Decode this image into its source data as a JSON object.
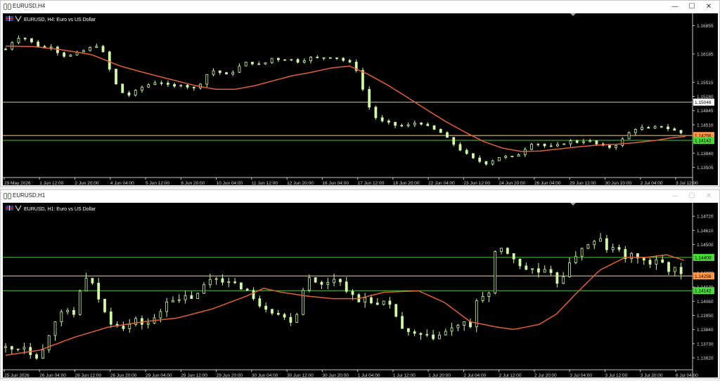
{
  "windows": [
    {
      "title": "EURUSD,H4",
      "header": "EURUSD, H4:  Euro vs US Dollar",
      "controls": {
        "minimize": "—",
        "maximize": "☐",
        "close": "✕"
      },
      "chart_data": {
        "type": "candlestick",
        "symbol": "EURUSD",
        "timeframe": "H4",
        "description": "Euro vs US Dollar",
        "y_ticks": [
          "1.16855",
          "1.16185",
          "1.15515",
          "1.15180",
          "1.14845",
          "1.14510",
          "1.13840",
          "1.13505"
        ],
        "y_tick_values": [
          1.16855,
          1.16185,
          1.15515,
          1.1518,
          1.14845,
          1.1451,
          1.1384,
          1.13505
        ],
        "ylim": [
          1.1333,
          1.1698
        ],
        "x_ticks": [
          "29 May 2026",
          "1 Jun 12:00",
          "2 Jun 20:00",
          "4 Jun 04:00",
          "5 Jun 12:00",
          "8 Jun 20:00",
          "10 Jun 04:00",
          "11 Jun 12:00",
          "12 Jun 20:00",
          "16 Jun 04:00",
          "17 Jun 12:00",
          "18 Jun 20:00",
          "22 Jun 04:00",
          "23 Jun 12:00",
          "24 Jun 20:00",
          "26 Jun 04:00",
          "29 Jun 12:00",
          "30 Jun 20:00",
          "2 Jul 04:00",
          "3 Jul 12:00"
        ],
        "hlines": [
          {
            "label": "1.15046",
            "value": 1.15046,
            "color": "#d8d818",
            "label_bg": "#ffffff",
            "label_fg": "#000000"
          },
          {
            "label": "1.14256",
            "value": 1.14256,
            "color": "#ffd080",
            "label_bg": "#ff9a4a",
            "label_fg": "#000000"
          },
          {
            "label": "1.14142",
            "value": 1.14142,
            "color": "#4ac83a",
            "label_bg": "#4ad83a",
            "label_fg": "#000000"
          }
        ],
        "colors": {
          "candle": "#d0f8a8",
          "ma": "#e0603a",
          "axis_text": "#d8d8d8"
        },
        "ma_points": [
          [
            0,
            1.1637
          ],
          [
            15,
            1.1636
          ],
          [
            30,
            1.1628
          ],
          [
            45,
            1.1617
          ],
          [
            60,
            1.159
          ],
          [
            72,
            1.1575
          ],
          [
            85,
            1.156
          ],
          [
            100,
            1.1543
          ],
          [
            110,
            1.1535
          ],
          [
            120,
            1.1535
          ],
          [
            130,
            1.1543
          ],
          [
            140,
            1.1555
          ],
          [
            150,
            1.1567
          ],
          [
            160,
            1.1575
          ],
          [
            170,
            1.1585
          ],
          [
            180,
            1.159
          ],
          [
            190,
            1.157
          ],
          [
            200,
            1.1545
          ],
          [
            210,
            1.1517
          ],
          [
            220,
            1.1488
          ],
          [
            230,
            1.146
          ],
          [
            240,
            1.1435
          ],
          [
            250,
            1.1412
          ],
          [
            260,
            1.1396
          ],
          [
            270,
            1.1388
          ],
          [
            280,
            1.1389
          ],
          [
            290,
            1.1394
          ],
          [
            300,
            1.1399
          ],
          [
            310,
            1.1403
          ],
          [
            320,
            1.1405
          ],
          [
            330,
            1.1409
          ],
          [
            340,
            1.1414
          ],
          [
            350,
            1.1421
          ],
          [
            360,
            1.1425
          ]
        ],
        "close_points": [
          [
            0,
            1.163
          ],
          [
            4,
            1.165
          ],
          [
            8,
            1.1662
          ],
          [
            12,
            1.165
          ],
          [
            16,
            1.164
          ],
          [
            20,
            1.1632
          ],
          [
            24,
            1.1638
          ],
          [
            28,
            1.162
          ],
          [
            32,
            1.1612
          ],
          [
            36,
            1.1618
          ],
          [
            40,
            1.1625
          ],
          [
            44,
            1.1632
          ],
          [
            48,
            1.164
          ],
          [
            52,
            1.1615
          ],
          [
            56,
            1.156
          ],
          [
            60,
            1.153
          ],
          [
            64,
            1.152
          ],
          [
            68,
            1.153
          ],
          [
            72,
            1.1542
          ],
          [
            76,
            1.1548
          ],
          [
            80,
            1.1555
          ],
          [
            84,
            1.1545
          ],
          [
            88,
            1.154
          ],
          [
            92,
            1.1548
          ],
          [
            96,
            1.154
          ],
          [
            100,
            1.1535
          ],
          [
            104,
            1.1565
          ],
          [
            108,
            1.158
          ],
          [
            112,
            1.1575
          ],
          [
            116,
            1.1568
          ],
          [
            120,
            1.158
          ],
          [
            124,
            1.1595
          ],
          [
            128,
            1.16
          ],
          [
            132,
            1.1592
          ],
          [
            136,
            1.1598
          ],
          [
            140,
            1.161
          ],
          [
            144,
            1.1605
          ],
          [
            148,
            1.1608
          ],
          [
            152,
            1.16
          ],
          [
            156,
            1.1605
          ],
          [
            160,
            1.161
          ],
          [
            164,
            1.1608
          ],
          [
            168,
            1.1612
          ],
          [
            172,
            1.1612
          ],
          [
            176,
            1.1605
          ],
          [
            180,
            1.1598
          ],
          [
            184,
            1.158
          ],
          [
            188,
            1.152
          ],
          [
            192,
            1.1475
          ],
          [
            196,
            1.146
          ],
          [
            200,
            1.1455
          ],
          [
            204,
            1.145
          ],
          [
            208,
            1.1448
          ],
          [
            212,
            1.145
          ],
          [
            216,
            1.146
          ],
          [
            220,
            1.1448
          ],
          [
            224,
            1.144
          ],
          [
            228,
            1.1432
          ],
          [
            232,
            1.1415
          ],
          [
            236,
            1.14
          ],
          [
            240,
            1.1385
          ],
          [
            244,
            1.1372
          ],
          [
            248,
            1.1365
          ],
          [
            252,
            1.136
          ],
          [
            256,
            1.137
          ],
          [
            260,
            1.1378
          ],
          [
            264,
            1.1372
          ],
          [
            268,
            1.138
          ],
          [
            272,
            1.1395
          ],
          [
            276,
            1.141
          ],
          [
            280,
            1.1405
          ],
          [
            284,
            1.1398
          ],
          [
            288,
            1.14
          ],
          [
            292,
            1.1408
          ],
          [
            296,
            1.1412
          ],
          [
            300,
            1.141
          ],
          [
            304,
            1.1415
          ],
          [
            308,
            1.1408
          ],
          [
            312,
            1.14
          ],
          [
            316,
            1.1398
          ],
          [
            320,
            1.1405
          ],
          [
            324,
            1.142
          ],
          [
            328,
            1.144
          ],
          [
            332,
            1.1445
          ],
          [
            336,
            1.144
          ],
          [
            340,
            1.1445
          ],
          [
            344,
            1.1448
          ],
          [
            348,
            1.144
          ],
          [
            352,
            1.1435
          ],
          [
            356,
            1.1428
          ]
        ]
      }
    },
    {
      "title": "EURUSD,H1",
      "header": "EURUSD, H1:  Euro vs US Dollar",
      "controls": {
        "minimize": "—",
        "maximize": "☐",
        "close": "✕"
      },
      "chart_data": {
        "type": "candlestick",
        "symbol": "EURUSD",
        "timeframe": "H1",
        "description": "Euro vs US Dollar",
        "y_ticks": [
          "1.14720",
          "1.14610",
          "1.14500",
          "1.14280",
          "1.14170",
          "1.14060",
          "1.13950",
          "1.13840",
          "1.13730",
          "1.13620"
        ],
        "y_tick_values": [
          1.1472,
          1.1461,
          1.145,
          1.1428,
          1.1417,
          1.1406,
          1.1395,
          1.1384,
          1.1373,
          1.1362
        ],
        "ylim": [
          1.1356,
          1.1477
        ],
        "x_ticks": [
          "25 Jun 2026",
          "26 Jun 04:00",
          "26 Jun 12:00",
          "26 Jun 20:00",
          "29 Jun 04:00",
          "29 Jun 12:00",
          "29 Jun 20:00",
          "30 Jun 04:00",
          "30 Jun 12:00",
          "30 Jun 20:00",
          "1 Jul 04:00",
          "1 Jul 12:00",
          "1 Jul 20:00",
          "2 Jul 04:00",
          "2 Jul 12:00",
          "2 Jul 20:00",
          "3 Jul 04:00",
          "3 Jul 12:00",
          "3 Jul 20:00",
          "6 Jul 04:00"
        ],
        "hlines": [
          {
            "label": "1.14400",
            "value": 1.144,
            "color": "#4ac83a",
            "label_bg": "#4ad83a",
            "label_fg": "#000000"
          },
          {
            "label": "1.14256",
            "value": 1.14256,
            "color": "#ffd080",
            "label_bg": "#ff9a4a",
            "label_fg": "#000000"
          },
          {
            "label": "1.14142",
            "value": 1.14142,
            "color": "#4ac83a",
            "label_bg": "#4ad83a",
            "label_fg": "#000000"
          }
        ],
        "colors": {
          "candle": "#d0f8a8",
          "ma": "#e0603a",
          "axis_text": "#d8d8d8"
        },
        "ma_points": [
          [
            0,
            1.1364
          ],
          [
            20,
            1.1368
          ],
          [
            40,
            1.1378
          ],
          [
            60,
            1.1386
          ],
          [
            80,
            1.139
          ],
          [
            100,
            1.1393
          ],
          [
            120,
            1.14
          ],
          [
            140,
            1.141
          ],
          [
            150,
            1.1416
          ],
          [
            160,
            1.1413
          ],
          [
            175,
            1.141
          ],
          [
            190,
            1.1408
          ],
          [
            205,
            1.1408
          ],
          [
            220,
            1.1413
          ],
          [
            240,
            1.1414
          ],
          [
            255,
            1.1405
          ],
          [
            270,
            1.139
          ],
          [
            285,
            1.1386
          ],
          [
            295,
            1.1384
          ],
          [
            310,
            1.1388
          ],
          [
            320,
            1.1396
          ],
          [
            330,
            1.141
          ],
          [
            345,
            1.143
          ],
          [
            360,
            1.144
          ],
          [
            372,
            1.144
          ],
          [
            384,
            1.1442
          ],
          [
            396,
            1.1437
          ]
        ],
        "close_points": [
          [
            0,
            1.137
          ],
          [
            5,
            1.1368
          ],
          [
            10,
            1.1372
          ],
          [
            15,
            1.1365
          ],
          [
            20,
            1.1362
          ],
          [
            25,
            1.138
          ],
          [
            30,
            1.1395
          ],
          [
            35,
            1.1398
          ],
          [
            40,
            1.1395
          ],
          [
            45,
            1.1425
          ],
          [
            50,
            1.142
          ],
          [
            55,
            1.1405
          ],
          [
            60,
            1.139
          ],
          [
            65,
            1.1388
          ],
          [
            70,
            1.1385
          ],
          [
            75,
            1.1392
          ],
          [
            80,
            1.1388
          ],
          [
            85,
            1.139
          ],
          [
            90,
            1.1398
          ],
          [
            95,
            1.141
          ],
          [
            100,
            1.1405
          ],
          [
            105,
            1.141
          ],
          [
            110,
            1.1408
          ],
          [
            115,
            1.1418
          ],
          [
            120,
            1.1425
          ],
          [
            125,
            1.1423
          ],
          [
            130,
            1.142
          ],
          [
            135,
            1.1418
          ],
          [
            140,
            1.1415
          ],
          [
            145,
            1.1405
          ],
          [
            150,
            1.1402
          ],
          [
            155,
            1.1398
          ],
          [
            160,
            1.1395
          ],
          [
            165,
            1.139
          ],
          [
            170,
            1.1398
          ],
          [
            175,
            1.1428
          ],
          [
            180,
            1.142
          ],
          [
            185,
            1.1418
          ],
          [
            190,
            1.1425
          ],
          [
            195,
            1.142
          ],
          [
            200,
            1.1412
          ],
          [
            205,
            1.1405
          ],
          [
            210,
            1.141
          ],
          [
            215,
            1.1402
          ],
          [
            220,
            1.1405
          ],
          [
            225,
            1.14
          ],
          [
            230,
            1.1385
          ],
          [
            235,
            1.138
          ],
          [
            240,
            1.138
          ],
          [
            245,
            1.1378
          ],
          [
            250,
            1.1378
          ],
          [
            255,
            1.1382
          ],
          [
            260,
            1.1385
          ],
          [
            265,
            1.139
          ],
          [
            270,
            1.1385
          ],
          [
            275,
            1.1415
          ],
          [
            280,
            1.1405
          ],
          [
            285,
            1.1448
          ],
          [
            290,
            1.1445
          ],
          [
            295,
            1.144
          ],
          [
            300,
            1.143
          ],
          [
            305,
            1.1432
          ],
          [
            310,
            1.1428
          ],
          [
            315,
            1.143
          ],
          [
            320,
            1.142
          ],
          [
            325,
            1.1428
          ],
          [
            330,
            1.144
          ],
          [
            335,
            1.1448
          ],
          [
            340,
            1.145
          ],
          [
            345,
            1.1455
          ],
          [
            350,
            1.1445
          ],
          [
            355,
            1.1448
          ],
          [
            360,
            1.144
          ],
          [
            365,
            1.1442
          ],
          [
            370,
            1.1438
          ],
          [
            375,
            1.1435
          ],
          [
            380,
            1.1438
          ],
          [
            385,
            1.143
          ],
          [
            390,
            1.1432
          ],
          [
            395,
            1.142
          ]
        ]
      }
    }
  ]
}
